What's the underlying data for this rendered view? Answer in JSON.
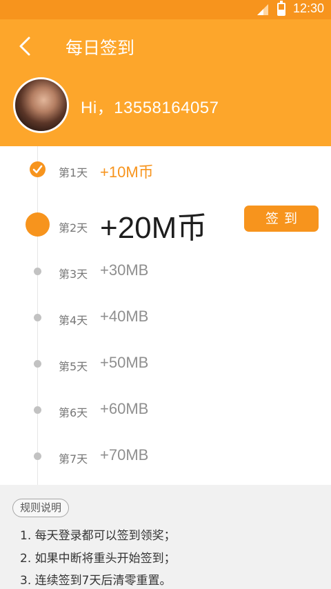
{
  "status_bar": {
    "time": "12:30"
  },
  "header": {
    "title": "每日签到",
    "greeting": "Hi，13558164057"
  },
  "checkin": {
    "days": [
      {
        "label": "第1天",
        "reward": "+10M币",
        "state": "done"
      },
      {
        "label": "第2天",
        "reward": "+20M币",
        "state": "current"
      },
      {
        "label": "第3天",
        "reward": "+30MB",
        "state": "pending"
      },
      {
        "label": "第4天",
        "reward": "+40MB",
        "state": "pending"
      },
      {
        "label": "第5天",
        "reward": "+50MB",
        "state": "pending"
      },
      {
        "label": "第6天",
        "reward": "+60MB",
        "state": "pending"
      },
      {
        "label": "第7天",
        "reward": "+70MB",
        "state": "pending"
      }
    ],
    "sign_button": "签到"
  },
  "rules": {
    "title": "规则说明",
    "items": [
      "1. 每天登录都可以签到领奖；",
      "2. 如果中断将重头开始签到；",
      "3. 连续签到7天后清零重置。"
    ]
  },
  "colors": {
    "accent": "#f7941d",
    "header_bg": "#fda62b",
    "muted": "#8f8f8f"
  }
}
